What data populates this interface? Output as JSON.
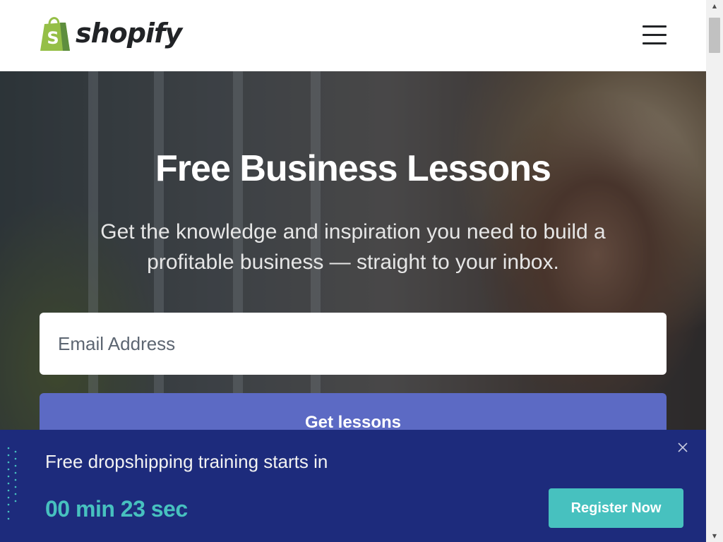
{
  "header": {
    "logo_text": "shopify",
    "menu_icon": "hamburger-menu-icon"
  },
  "hero": {
    "title": "Free Business Lessons",
    "subtitle": "Get the knowledge and inspiration you need to build a profitable business — straight to your inbox.",
    "email_placeholder": "Email Address",
    "cta_label": "Get lessons"
  },
  "banner": {
    "text": "Free dropshipping training starts in",
    "countdown": "00 min 23 sec",
    "register_label": "Register Now",
    "close_icon": "close-icon"
  },
  "colors": {
    "brand_green": "#95bf47",
    "cta_purple": "#5c6ac4",
    "banner_navy": "#1d2b7c",
    "accent_teal": "#47c1bf"
  }
}
